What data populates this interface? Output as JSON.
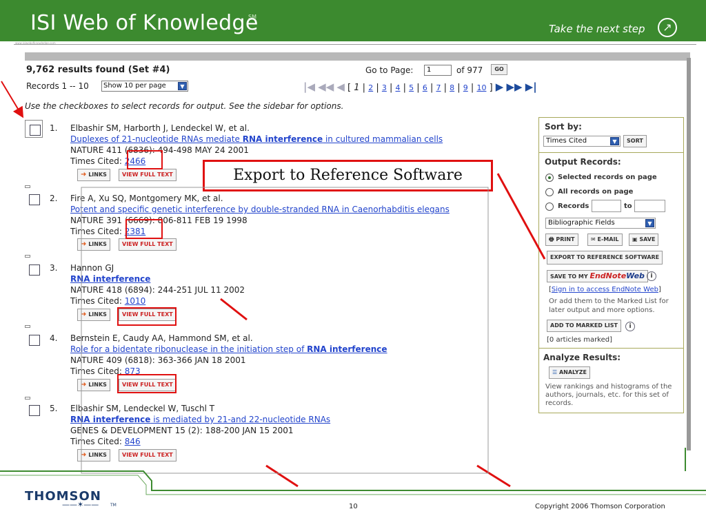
{
  "banner": {
    "title": "ISI Web of Knowledge",
    "tm": "SM",
    "tagline": "Take the next step",
    "tag_icon": "arrow-circle-icon"
  },
  "tiny_label": "www.isiwebofknowledge.com",
  "results": {
    "count": "9,762 results found (Set #4)",
    "range": "Records 1 -- 10",
    "per_page": "Show 10 per page",
    "goto_label": "Go to Page:",
    "goto_value": "1",
    "of_pages": "of 977",
    "go": "GO",
    "pages": [
      "1",
      "2",
      "3",
      "4",
      "5",
      "6",
      "7",
      "8",
      "9",
      "10"
    ],
    "current_page": "1",
    "instructions": "Use the checkboxes to select records for output. See the sidebar for options."
  },
  "records": [
    {
      "num": "1.",
      "authors": "Elbashir SM, Harborth J, Lendeckel W, et al.",
      "title_pre": "Duplexes of 21-nucleotide RNAs mediate ",
      "title_bold": "RNA interference",
      "title_post": " in cultured mammalian cells",
      "source": "NATURE 411 (6836): 494-498 MAY 24 2001",
      "cited_label": "Times Cited:",
      "cited": "2466"
    },
    {
      "num": "2.",
      "authors": "Fire A, Xu SQ, Montgomery MK, et al.",
      "title_pre": "Potent and specific genetic interference by double-stranded RNA in Caenorhabditis elegans",
      "title_bold": "",
      "title_post": "",
      "source": "NATURE 391 (6669): 806-811 FEB 19 1998",
      "cited_label": "Times Cited:",
      "cited": "2381"
    },
    {
      "num": "3.",
      "authors": "Hannon GJ",
      "title_pre": "",
      "title_bold": "RNA interference",
      "title_post": "",
      "source": "NATURE 418 (6894): 244-251 JUL 11 2002",
      "cited_label": "Times Cited:",
      "cited": "1010"
    },
    {
      "num": "4.",
      "authors": "Bernstein E, Caudy AA, Hammond SM, et al.",
      "title_pre": "Role for a bidentate ribonuclease in the initiation step of ",
      "title_bold": "RNA interference",
      "title_post": "",
      "source": "NATURE 409 (6818): 363-366 JAN 18 2001",
      "cited_label": "Times Cited:",
      "cited": "873"
    },
    {
      "num": "5.",
      "authors": "Elbashir SM, Lendeckel W, Tuschl T",
      "title_pre": "",
      "title_bold": "RNA interference",
      "title_post": " is mediated by 21-and 22-nucleotide RNAs",
      "source": "GENES & DEVELOPMENT 15 (2): 188-200 JAN 15 2001",
      "cited_label": "Times Cited:",
      "cited": "846"
    }
  ],
  "record_actions": {
    "links": "LINKS",
    "full_text": "VIEW FULL TEXT"
  },
  "sidebar": {
    "sort_by": "Sort by:",
    "sort_value": "Times Cited",
    "sort_btn": "SORT",
    "output_records": "Output Records:",
    "opt_selected": "Selected records on page",
    "opt_all": "All records on page",
    "opt_records": "Records",
    "to": "to",
    "fields": "Bibliographic Fields",
    "print": "PRINT",
    "email": "E-MAIL",
    "save": "SAVE",
    "export": "EXPORT TO REFERENCE SOFTWARE",
    "save_to_my": "SAVE TO MY",
    "endnote": "EndNote",
    "web": "Web",
    "signin": "Sign in to access EndNote Web",
    "marked_text": "Or add them to the Marked List for later output and more options.",
    "add_marked": "ADD TO MARKED LIST",
    "marked_count": "[0 articles marked]",
    "analyze_results": "Analyze Results:",
    "analyze": "ANALYZE",
    "analyze_text": "View rankings and histograms of the authors, journals, etc. for this set of records."
  },
  "callout": "Export to Reference Software",
  "footer": {
    "brand": "THOMSON",
    "tm": "TM",
    "page": "10",
    "copyright": "Copyright 2006 Thomson Corporation"
  },
  "colors": {
    "banner": "#3c8a2f",
    "annotation": "#e01010",
    "link": "#2244cc"
  }
}
